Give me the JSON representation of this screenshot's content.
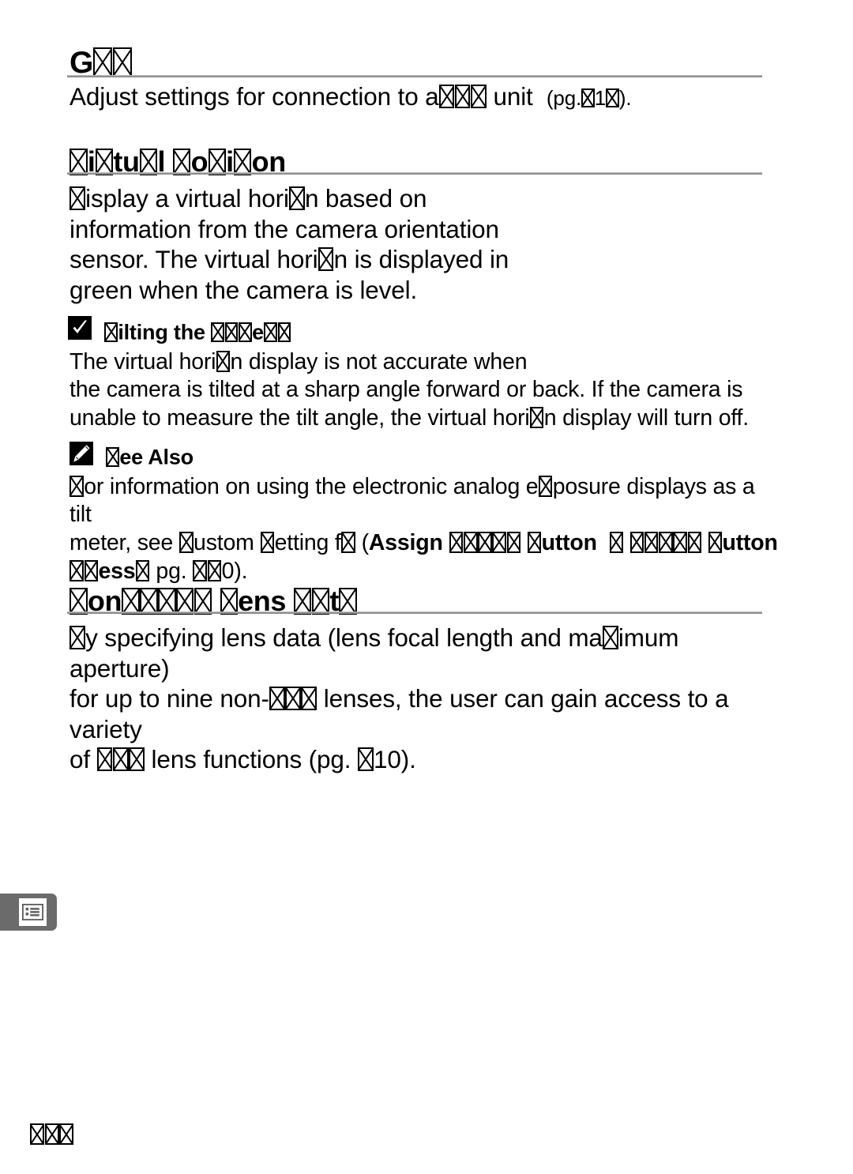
{
  "document": {
    "type": "camera-manual-page",
    "page_number_glyphs": "???"
  },
  "sections": [
    {
      "id": "gps",
      "heading": "G???",
      "heading_parts": [
        "G",
        "tofu",
        "tofu",
        "tofu"
      ],
      "body": "Adjust settings for connection to a ??? unit  (pg. ?1?)."
    },
    {
      "id": "virtual-horizon",
      "heading": "?i?tu?l ?o?i?on",
      "body": "?isplay a virtual hori?n based on information from the camera orientation sensor.  The virtual hori?n is displayed in green when the camera is level."
    },
    {
      "id": "non-cpu-lens-data",
      "heading": "?on????? ?ens ??t?",
      "body": "?y specifying lens data (lens focal length and ma?imum aperture) for up to nine non-??? lenses, the user can gain access to a variety of ??? lens functions  (pg. ?10)."
    }
  ],
  "notes": [
    {
      "id": "tilting-the-camera",
      "icon": "checkmark-icon",
      "title": "?ilting the ???e??",
      "body": "The virtual hori?n display is not accurate when the camera is tilted at a sharp angle forward or back.  If the camera is unable to measure the tilt angle, the virtual hori?n display will turn off."
    },
    {
      "id": "see-also",
      "icon": "pencil-icon",
      "title": "?ee Also",
      "body": "?or information on using the electronic analog e?posure displays as a tilt meter, see ?ustom ?etting f? (Assign ????? ?utton ? ????? ?utton ??ess? pg. ??0)."
    }
  ],
  "side_tab": {
    "icon": "list-menu-icon",
    "background": "#6b6b6b"
  },
  "lines": {
    "gps_body": "Adjust settings for connection to a",
    "gps_body_2": "unit",
    "gps_ref_open": "(pg.",
    "gps_ref_mid": "1",
    "gps_ref_close": ").",
    "vh_l1_a": "isplay a virtual hori",
    "vh_l1_b": "n based on",
    "vh_l2": "information from the camera orientation",
    "vh_l3_a": "sensor.  The virtual hori",
    "vh_l3_b": "n is displayed in",
    "vh_l4": "green when the camera is level.",
    "tilt_title_a": "ilting the",
    "tilt_l1_a": "The virtual hori",
    "tilt_l1_b": "n display is not accurate when",
    "tilt_l2": "the camera is tilted at a sharp angle forward or back.  If the camera is",
    "tilt_l3_a": "unable to measure the tilt angle, the virtual hori",
    "tilt_l3_b": "n display will turn off.",
    "see_title": "ee Also",
    "see_l1_a": "or information on using the electronic analog e",
    "see_l1_b": "posure displays as a tilt",
    "see_l2_a": "meter, see",
    "see_l2_b": "ustom",
    "see_l2_c": "etting f",
    "see_l2_d": "(",
    "see_l2_assign": "Assign",
    "see_l2_button1": "utton",
    "see_l2_button2": "utton",
    "see_l3_press": "ess",
    "see_l3_pg": "pg.",
    "see_l3_zero": "0).",
    "ncpu_l1_a": "y specifying lens data (lens focal length and ma",
    "ncpu_l1_b": "imum aperture)",
    "ncpu_l2_a": "for up to nine non-",
    "ncpu_l2_b": "lenses, the user can gain access to a variety",
    "ncpu_l3_a": "of",
    "ncpu_l3_b": "lens functions  (pg.",
    "ncpu_l3_c": "10)."
  },
  "headings": {
    "gps_letter": "G",
    "vh_i": "i",
    "vh_tul": "tu",
    "vh_l": "l",
    "vh_o": "o",
    "vh_i2": "i",
    "vh_on": "on",
    "ncpu_on": "on",
    "ncpu_ens": "ens",
    "ncpu_t": "t"
  }
}
